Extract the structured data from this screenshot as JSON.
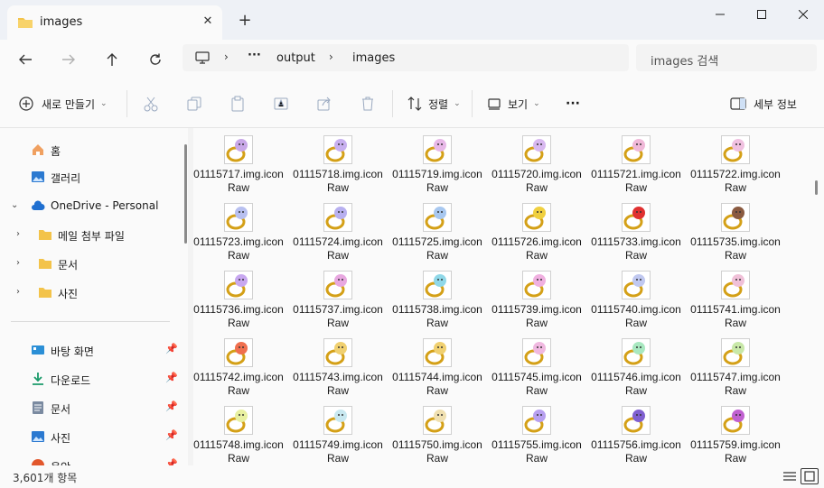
{
  "window": {
    "tab_title": "images",
    "tab_close_icon": "close-icon",
    "new_tab_icon": "plus-icon",
    "minimize_icon": "minimize-icon",
    "maximize_icon": "maximize-icon",
    "close_icon": "close-icon"
  },
  "address": {
    "back_icon": "arrow-left-icon",
    "forward_icon": "arrow-right-icon",
    "up_icon": "arrow-up-icon",
    "refresh_icon": "refresh-icon",
    "ellipsis": "···",
    "crumbs": [
      "output",
      "images"
    ],
    "search_placeholder": "images 검색"
  },
  "toolbar": {
    "new_label": "새로 만들기",
    "sort_label": "정렬",
    "view_label": "보기",
    "more_label": "···",
    "details_label": "세부 정보"
  },
  "sidebar": {
    "items": [
      {
        "label": "홈"
      },
      {
        "label": "갤러리"
      },
      {
        "label": "OneDrive - Personal"
      },
      {
        "label": "메일 첨부 파일"
      },
      {
        "label": "문서"
      },
      {
        "label": "사진"
      },
      {
        "label": "바탕 화면"
      },
      {
        "label": "다운로드"
      },
      {
        "label": "문서"
      },
      {
        "label": "사진"
      },
      {
        "label": "음악"
      }
    ]
  },
  "files": [
    {
      "name": "01115717.img.iconRaw",
      "color": "#c9a8e8"
    },
    {
      "name": "01115718.img.iconRaw",
      "color": "#c8b0f0"
    },
    {
      "name": "01115719.img.iconRaw",
      "color": "#e8b8e8"
    },
    {
      "name": "01115720.img.iconRaw",
      "color": "#d8b8f0"
    },
    {
      "name": "01115721.img.iconRaw",
      "color": "#f0b8d8"
    },
    {
      "name": "01115722.img.iconRaw",
      "color": "#f0c0e0"
    },
    {
      "name": "01115723.img.iconRaw",
      "color": "#b8c0f0"
    },
    {
      "name": "01115724.img.iconRaw",
      "color": "#b8b0f0"
    },
    {
      "name": "01115725.img.iconRaw",
      "color": "#a8c8f0"
    },
    {
      "name": "01115726.img.iconRaw",
      "color": "#f0d040"
    },
    {
      "name": "01115733.img.iconRaw",
      "color": "#e03030"
    },
    {
      "name": "01115735.img.iconRaw",
      "color": "#8a5a40"
    },
    {
      "name": "01115736.img.iconRaw",
      "color": "#c8a8f0"
    },
    {
      "name": "01115737.img.iconRaw",
      "color": "#e8a8e0"
    },
    {
      "name": "01115738.img.iconRaw",
      "color": "#90d8e8"
    },
    {
      "name": "01115739.img.iconRaw",
      "color": "#f0b0e0"
    },
    {
      "name": "01115740.img.iconRaw",
      "color": "#c0c8f0"
    },
    {
      "name": "01115741.img.iconRaw",
      "color": "#f0c0d8"
    },
    {
      "name": "01115742.img.iconRaw",
      "color": "#f07050"
    },
    {
      "name": "01115743.img.iconRaw",
      "color": "#f0d070"
    },
    {
      "name": "01115744.img.iconRaw",
      "color": "#f0d070"
    },
    {
      "name": "01115745.img.iconRaw",
      "color": "#f0b8e0"
    },
    {
      "name": "01115746.img.iconRaw",
      "color": "#a8e8c0"
    },
    {
      "name": "01115747.img.iconRaw",
      "color": "#c8e8a8"
    },
    {
      "name": "01115748.img.iconRaw",
      "color": "#e8f0a0"
    },
    {
      "name": "01115749.img.iconRaw",
      "color": "#c8e8f0"
    },
    {
      "name": "01115750.img.iconRaw",
      "color": "#f0e0b0"
    },
    {
      "name": "01115755.img.iconRaw",
      "color": "#b8a0f0"
    },
    {
      "name": "01115756.img.iconRaw",
      "color": "#8060d0"
    },
    {
      "name": "01115759.img.iconRaw",
      "color": "#c060d0"
    }
  ],
  "status": {
    "count": "3,601개 항목"
  },
  "colors": {
    "folder": "#f3c34a",
    "accent": "#0067c0",
    "ring_gold": "#d4a017"
  }
}
